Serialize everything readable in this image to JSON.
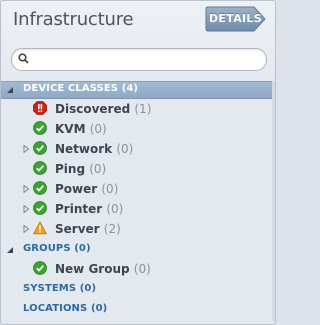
{
  "header": {
    "title": "Infrastructure",
    "details_label": "DETAILS"
  },
  "search": {
    "value": "",
    "placeholder": ""
  },
  "device_classes": {
    "label": "DEVICE CLASSES",
    "count": "(4)",
    "items": [
      {
        "label": "Discovered",
        "count": "(1)",
        "status": "error"
      },
      {
        "label": "KVM",
        "count": "(0)",
        "status": "ok"
      },
      {
        "label": "Network",
        "count": "(0)",
        "status": "ok"
      },
      {
        "label": "Ping",
        "count": "(0)",
        "status": "ok"
      },
      {
        "label": "Power",
        "count": "(0)",
        "status": "ok"
      },
      {
        "label": "Printer",
        "count": "(0)",
        "status": "ok"
      },
      {
        "label": "Server",
        "count": "(2)",
        "status": "warning"
      }
    ]
  },
  "groups": {
    "label": "GROUPS",
    "count": "(0)",
    "items": [
      {
        "label": "New Group",
        "count": "(0)",
        "status": "ok"
      }
    ]
  },
  "systems": {
    "label": "SYSTEMS",
    "count": "(0)"
  },
  "locations": {
    "label": "LOCATIONS",
    "count": "(0)"
  },
  "colors": {
    "accent_blue": "#2b6aa3",
    "selected_bg": "#9bb2cd",
    "ok_green": "#3aa22f",
    "error_red": "#d0201a",
    "warning_orange": "#f0a020"
  }
}
